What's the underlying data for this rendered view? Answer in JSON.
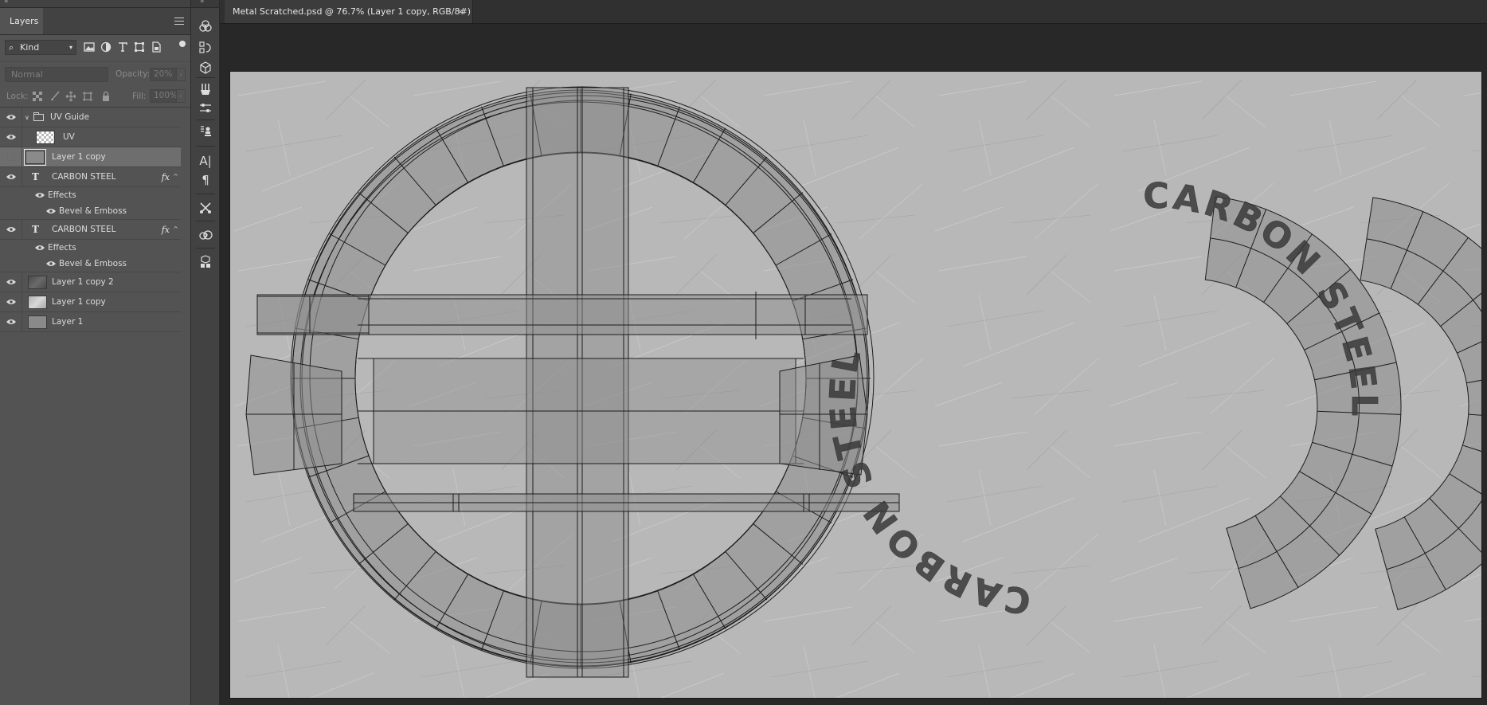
{
  "layers_panel": {
    "tab_title": "Layers",
    "filter": {
      "kind_label": "Kind"
    },
    "blend_mode": "Normal",
    "opacity_label": "Opacity:",
    "opacity_value": "20%",
    "lock_label": "Lock:",
    "fill_label": "Fill:",
    "fill_value": "100%",
    "layers": [
      {
        "name": "UV Guide",
        "kind": "group",
        "visible": true
      },
      {
        "name": "UV",
        "kind": "pixel",
        "visible": true
      },
      {
        "name": "Layer 1 copy",
        "kind": "pixel",
        "visible": false,
        "selected": true
      },
      {
        "name": "CARBON STEEL",
        "kind": "text",
        "visible": true,
        "fx": "fx"
      },
      {
        "name": "Effects",
        "kind": "effects",
        "visible": true
      },
      {
        "name": "Bevel & Emboss",
        "kind": "effect",
        "visible": true
      },
      {
        "name": "CARBON STEEL",
        "kind": "text",
        "visible": true,
        "fx": "fx"
      },
      {
        "name": "Effects",
        "kind": "effects",
        "visible": true
      },
      {
        "name": "Bevel & Emboss",
        "kind": "effect",
        "visible": true
      },
      {
        "name": "Layer 1 copy 2",
        "kind": "pixel",
        "visible": true
      },
      {
        "name": "Layer 1 copy",
        "kind": "pixel",
        "visible": true
      },
      {
        "name": "Layer 1",
        "kind": "pixel",
        "visible": true
      }
    ]
  },
  "document": {
    "tab_title": "Metal Scratched.psd @ 76.7% (Layer 1 copy, RGB/8#)",
    "close_glyph": "×",
    "canvas_text_1": "CARBON STEEL",
    "canvas_text_2": "CARBON STEEL"
  },
  "tools": {
    "character_glyph": "A|",
    "paragraph_glyph": "¶"
  },
  "colors": {
    "panel_bg": "#535353",
    "selected_row": "#6e6e6e",
    "canvas_metal": "#b9b9b9",
    "uv_fill": "#8a8a8a",
    "wire": "#1e1e1e"
  }
}
